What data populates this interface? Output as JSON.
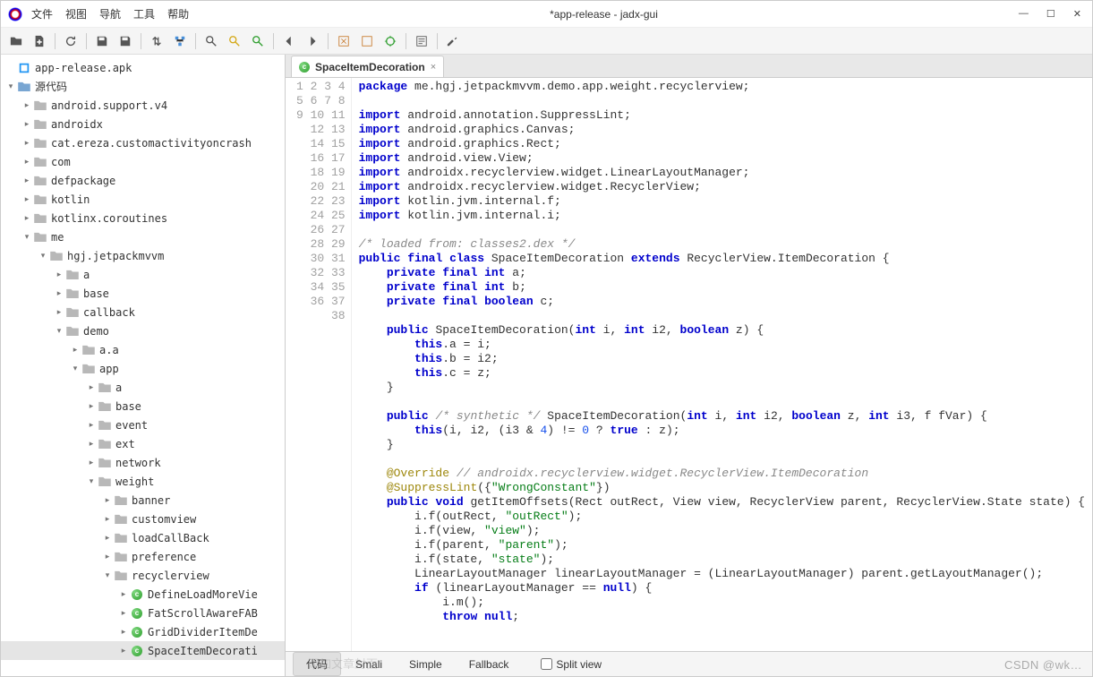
{
  "window": {
    "title": "*app-release - jadx-gui"
  },
  "menus": [
    "文件",
    "视图",
    "导航",
    "工具",
    "帮助"
  ],
  "tree": {
    "root": "app-release.apk",
    "src": "源代码",
    "pkgs": [
      "android.support.v4",
      "androidx",
      "cat.ereza.customactivityoncrash",
      "com",
      "defpackage",
      "kotlin",
      "kotlinx.coroutines",
      "me"
    ],
    "me_children": {
      "hgj": "hgj.jetpackmvvm",
      "hgj_children": [
        "a",
        "base",
        "callback",
        "demo"
      ],
      "demo_children": [
        "a.a",
        "app"
      ],
      "app_children": [
        "a",
        "base",
        "event",
        "ext",
        "network",
        "weight"
      ],
      "weight_children_pkgs": [
        "banner",
        "customview",
        "loadCallBack",
        "preference",
        "recyclerview"
      ],
      "rv_classes": [
        "DefineLoadMoreVie",
        "FatScrollAwareFAB",
        "GridDividerItemDe",
        "SpaceItemDecorati"
      ]
    }
  },
  "tab": {
    "name": "SpaceItemDecoration",
    "close": "×"
  },
  "code": {
    "lines": [
      {
        "n": 1,
        "t": "<kw>package</kw> me.hgj.jetpackmvvm.demo.app.weight.recyclerview;"
      },
      {
        "n": 2,
        "t": ""
      },
      {
        "n": 3,
        "t": "<kw>import</kw> android.annotation.SuppressLint;"
      },
      {
        "n": 4,
        "t": "<kw>import</kw> android.graphics.Canvas;"
      },
      {
        "n": 5,
        "t": "<kw>import</kw> android.graphics.Rect;"
      },
      {
        "n": 6,
        "t": "<kw>import</kw> android.view.View;"
      },
      {
        "n": 7,
        "t": "<kw>import</kw> androidx.recyclerview.widget.LinearLayoutManager;"
      },
      {
        "n": 8,
        "t": "<kw>import</kw> androidx.recyclerview.widget.RecyclerView;"
      },
      {
        "n": 9,
        "t": "<kw>import</kw> kotlin.jvm.internal.f;"
      },
      {
        "n": 10,
        "t": "<kw>import</kw> kotlin.jvm.internal.i;"
      },
      {
        "n": 11,
        "t": ""
      },
      {
        "n": 12,
        "t": "<cm>/* loaded from: classes2.dex */</cm>"
      },
      {
        "n": 13,
        "t": "<kw>public</kw> <kw>final</kw> <kw>class</kw> SpaceItemDecoration <kw>extends</kw> RecyclerView.ItemDecoration {"
      },
      {
        "n": 14,
        "t": "    <kw>private</kw> <kw>final</kw> <kw>int</kw> a;"
      },
      {
        "n": 15,
        "t": "    <kw>private</kw> <kw>final</kw> <kw>int</kw> b;"
      },
      {
        "n": 16,
        "t": "    <kw>private</kw> <kw>final</kw> <kw>boolean</kw> c;"
      },
      {
        "n": 17,
        "t": ""
      },
      {
        "n": 18,
        "t": "    <kw>public</kw> SpaceItemDecoration(<kw>int</kw> i, <kw>int</kw> i2, <kw>boolean</kw> z) {"
      },
      {
        "n": 19,
        "t": "        <kw>this</kw>.a = i;"
      },
      {
        "n": 20,
        "t": "        <kw>this</kw>.b = i2;"
      },
      {
        "n": 21,
        "t": "        <kw>this</kw>.c = z;"
      },
      {
        "n": 22,
        "t": "    }"
      },
      {
        "n": 23,
        "t": ""
      },
      {
        "n": 24,
        "t": "    <kw>public</kw> <cm>/* synthetic */</cm> SpaceItemDecoration(<kw>int</kw> i, <kw>int</kw> i2, <kw>boolean</kw> z, <kw>int</kw> i3, f fVar) {"
      },
      {
        "n": 25,
        "t": "        <kw>this</kw>(i, i2, (i3 &amp; <num>4</num>) != <num>0</num> ? <kw>true</kw> : z);"
      },
      {
        "n": 26,
        "t": "    }"
      },
      {
        "n": 27,
        "t": ""
      },
      {
        "n": 28,
        "t": "    <an>@Override</an> <cm2>// androidx.recyclerview.widget.RecyclerView.ItemDecoration</cm2>"
      },
      {
        "n": 29,
        "t": "    <an>@SuppressLint</an>({<str>\"WrongConstant\"</str>})"
      },
      {
        "n": 30,
        "t": "    <kw>public</kw> <kw>void</kw> getItemOffsets(Rect outRect, View view, RecyclerView parent, RecyclerView.State state) {"
      },
      {
        "n": 31,
        "t": "        i.f(outRect, <str>\"outRect\"</str>);"
      },
      {
        "n": 32,
        "t": "        i.f(view, <str>\"view\"</str>);"
      },
      {
        "n": 33,
        "t": "        i.f(parent, <str>\"parent\"</str>);"
      },
      {
        "n": 34,
        "t": "        i.f(state, <str>\"state\"</str>);"
      },
      {
        "n": 35,
        "t": "        LinearLayoutManager linearLayoutManager = (LinearLayoutManager) parent.getLayoutManager();"
      },
      {
        "n": 36,
        "t": "        <kw>if</kw> (linearLayoutManager == <kw>null</kw>) {"
      },
      {
        "n": 37,
        "t": "            i.m();"
      },
      {
        "n": 38,
        "t": "            <kw>throw null</kw>;"
      }
    ]
  },
  "bottom": {
    "tabs": [
      "代码",
      "Smali",
      "Simple",
      "Fallback"
    ],
    "split": "Split view"
  },
  "watermark": "CSDN @wk…",
  "faded": "添加文章封面"
}
